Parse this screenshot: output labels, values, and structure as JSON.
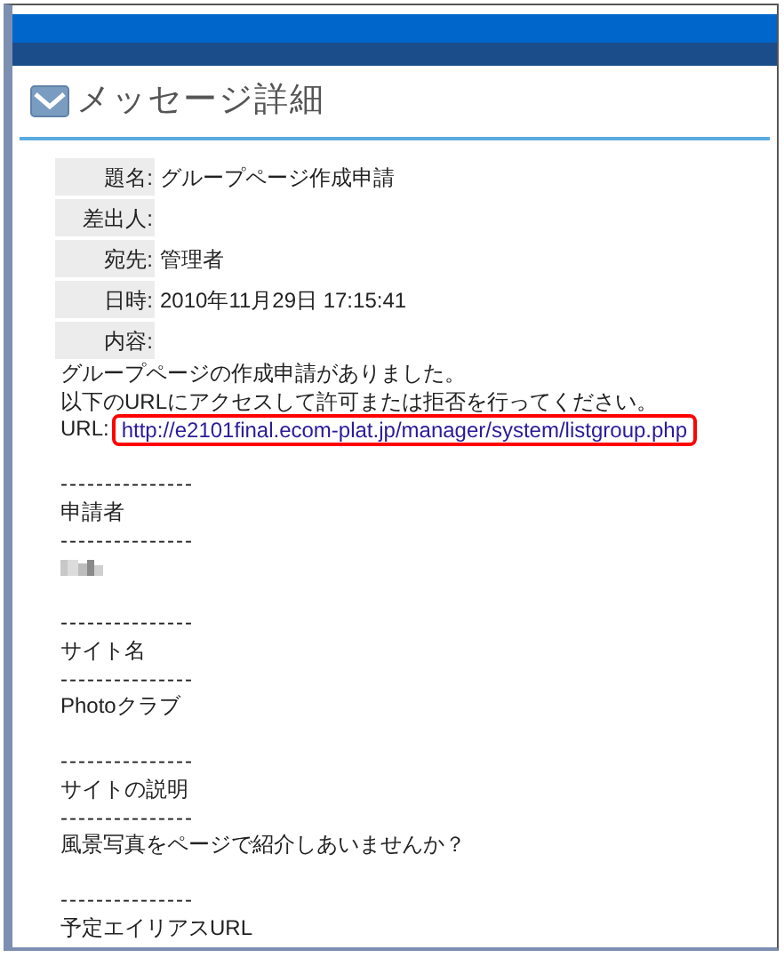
{
  "page": {
    "title": "メッセージ詳細"
  },
  "fields": [
    {
      "label": "題名:",
      "value": "グループページ作成申請"
    },
    {
      "label": "差出人:"
    },
    {
      "label": "宛先:",
      "value": "管理者"
    },
    {
      "label": "日時:",
      "value": "2010年11月29日 17:15:41"
    },
    {
      "label": "内容:"
    }
  ],
  "body": [
    {
      "kind": "text",
      "text": "グループページの作成申請がありました。"
    },
    {
      "kind": "text",
      "text": "以下のURLにアクセスして許可または拒否を行ってください。"
    },
    {
      "kind": "link",
      "label": "URL:",
      "text": "http://e2101final.ecom-plat.jp/manager/system/listgroup.php",
      "highlighted": true
    },
    {
      "kind": "gap"
    },
    {
      "kind": "divider",
      "text": "---------------"
    },
    {
      "kind": "text",
      "text": "申請者"
    },
    {
      "kind": "divider",
      "text": "---------------"
    },
    {
      "kind": "redacted"
    },
    {
      "kind": "gap"
    },
    {
      "kind": "divider",
      "text": "---------------"
    },
    {
      "kind": "text",
      "text": "サイト名"
    },
    {
      "kind": "divider",
      "text": "---------------"
    },
    {
      "kind": "text",
      "text": "Photoクラブ"
    },
    {
      "kind": "gap"
    },
    {
      "kind": "divider",
      "text": "---------------"
    },
    {
      "kind": "text",
      "text": "サイトの説明"
    },
    {
      "kind": "divider",
      "text": "---------------"
    },
    {
      "kind": "text",
      "text": "風景写真をページで紹介しあいませんか？"
    },
    {
      "kind": "gap"
    },
    {
      "kind": "divider",
      "text": "---------------"
    },
    {
      "kind": "text",
      "text": "予定エイリアスURL"
    }
  ]
}
